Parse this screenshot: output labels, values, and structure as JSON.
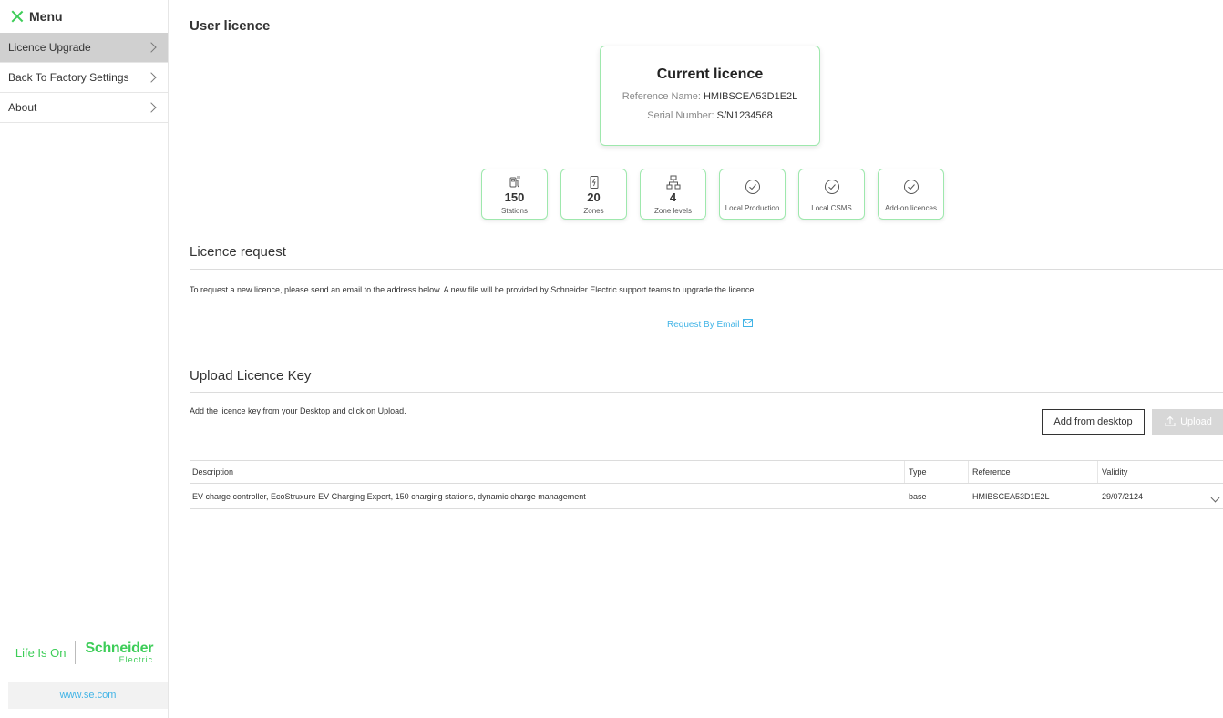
{
  "sidebar": {
    "menu_title": "Menu",
    "items": [
      {
        "label": "Licence Upgrade",
        "active": true
      },
      {
        "label": "Back To Factory Settings",
        "active": false
      },
      {
        "label": "About",
        "active": false
      }
    ],
    "brand_tagline": "Life Is On",
    "brand_name": "Schneider",
    "brand_sub": "Electric",
    "footer_url": "www.se.com"
  },
  "main": {
    "title": "User licence",
    "current_licence": {
      "heading": "Current licence",
      "reference_label": "Reference Name:",
      "reference_value": "HMIBSCEA53D1E2L",
      "serial_label": "Serial Number:",
      "serial_value": "S/N1234568"
    },
    "tiles": [
      {
        "icon": "stations-icon",
        "value": "150",
        "label": "Stations"
      },
      {
        "icon": "zones-icon",
        "value": "20",
        "label": "Zones"
      },
      {
        "icon": "zone-levels-icon",
        "value": "4",
        "label": "Zone levels"
      },
      {
        "icon": "check-circle-icon",
        "value": "",
        "label": "Local Production"
      },
      {
        "icon": "check-circle-icon",
        "value": "",
        "label": "Local CSMS"
      },
      {
        "icon": "check-circle-icon",
        "value": "",
        "label": "Add-on licences"
      }
    ],
    "licence_request": {
      "title": "Licence request",
      "text": "To request a new licence, please send an email to the address below. A new file will be provided by Schneider Electric support teams to upgrade the licence.",
      "link_label": "Request By Email"
    },
    "upload": {
      "title": "Upload Licence Key",
      "text": "Add the licence key from your Desktop and click on Upload.",
      "add_button": "Add from desktop",
      "upload_button": "Upload"
    },
    "table": {
      "headers": [
        "Description",
        "Type",
        "Reference",
        "Validity"
      ],
      "rows": [
        [
          "EV charge controller, EcoStruxure EV Charging Expert, 150 charging stations, dynamic charge management",
          "base",
          "HMIBSCEA53D1E2L",
          "29/07/2124"
        ]
      ]
    }
  },
  "colors": {
    "accent_green": "#3dcd58",
    "link_blue": "#42b4e6",
    "active_item_bg": "#d0d0d0"
  }
}
